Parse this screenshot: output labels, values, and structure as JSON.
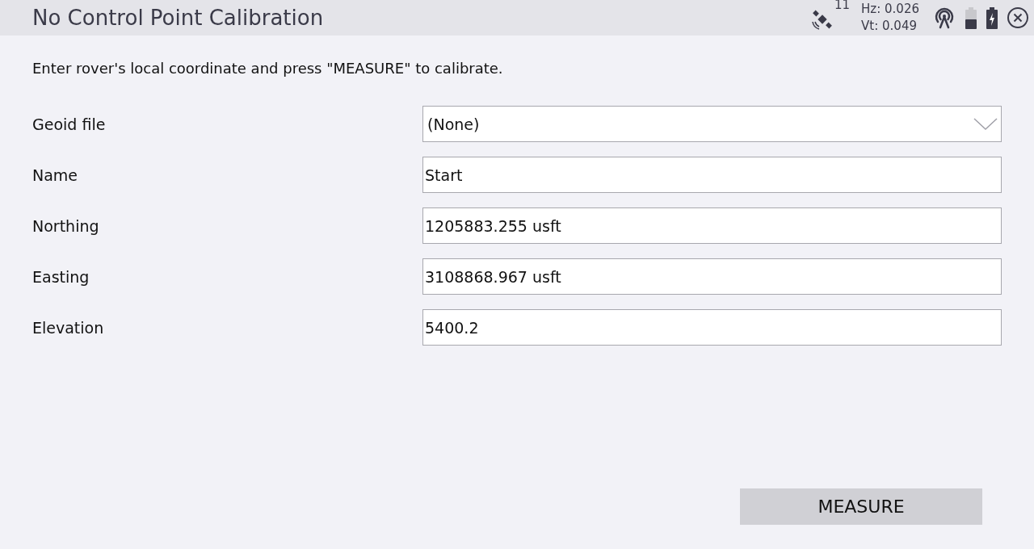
{
  "window": {
    "title": "No Control Point Calibration"
  },
  "status": {
    "satellites": "11",
    "hz": "Hz: 0.026",
    "vt": "Vt: 0.049"
  },
  "instruction": "Enter rover's local coordinate and press \"MEASURE\" to calibrate.",
  "fields": [
    {
      "label": "Geoid file",
      "kind": "dropdown",
      "value": "(None)"
    },
    {
      "label": "Name",
      "kind": "text",
      "value": "Start"
    },
    {
      "label": "Northing",
      "kind": "text",
      "value": "1205883.255 usft"
    },
    {
      "label": "Easting",
      "kind": "text",
      "value": "3108868.967 usft"
    },
    {
      "label": "Elevation",
      "kind": "text",
      "value": "5400.2"
    }
  ],
  "buttons": [
    "MEASURE"
  ]
}
